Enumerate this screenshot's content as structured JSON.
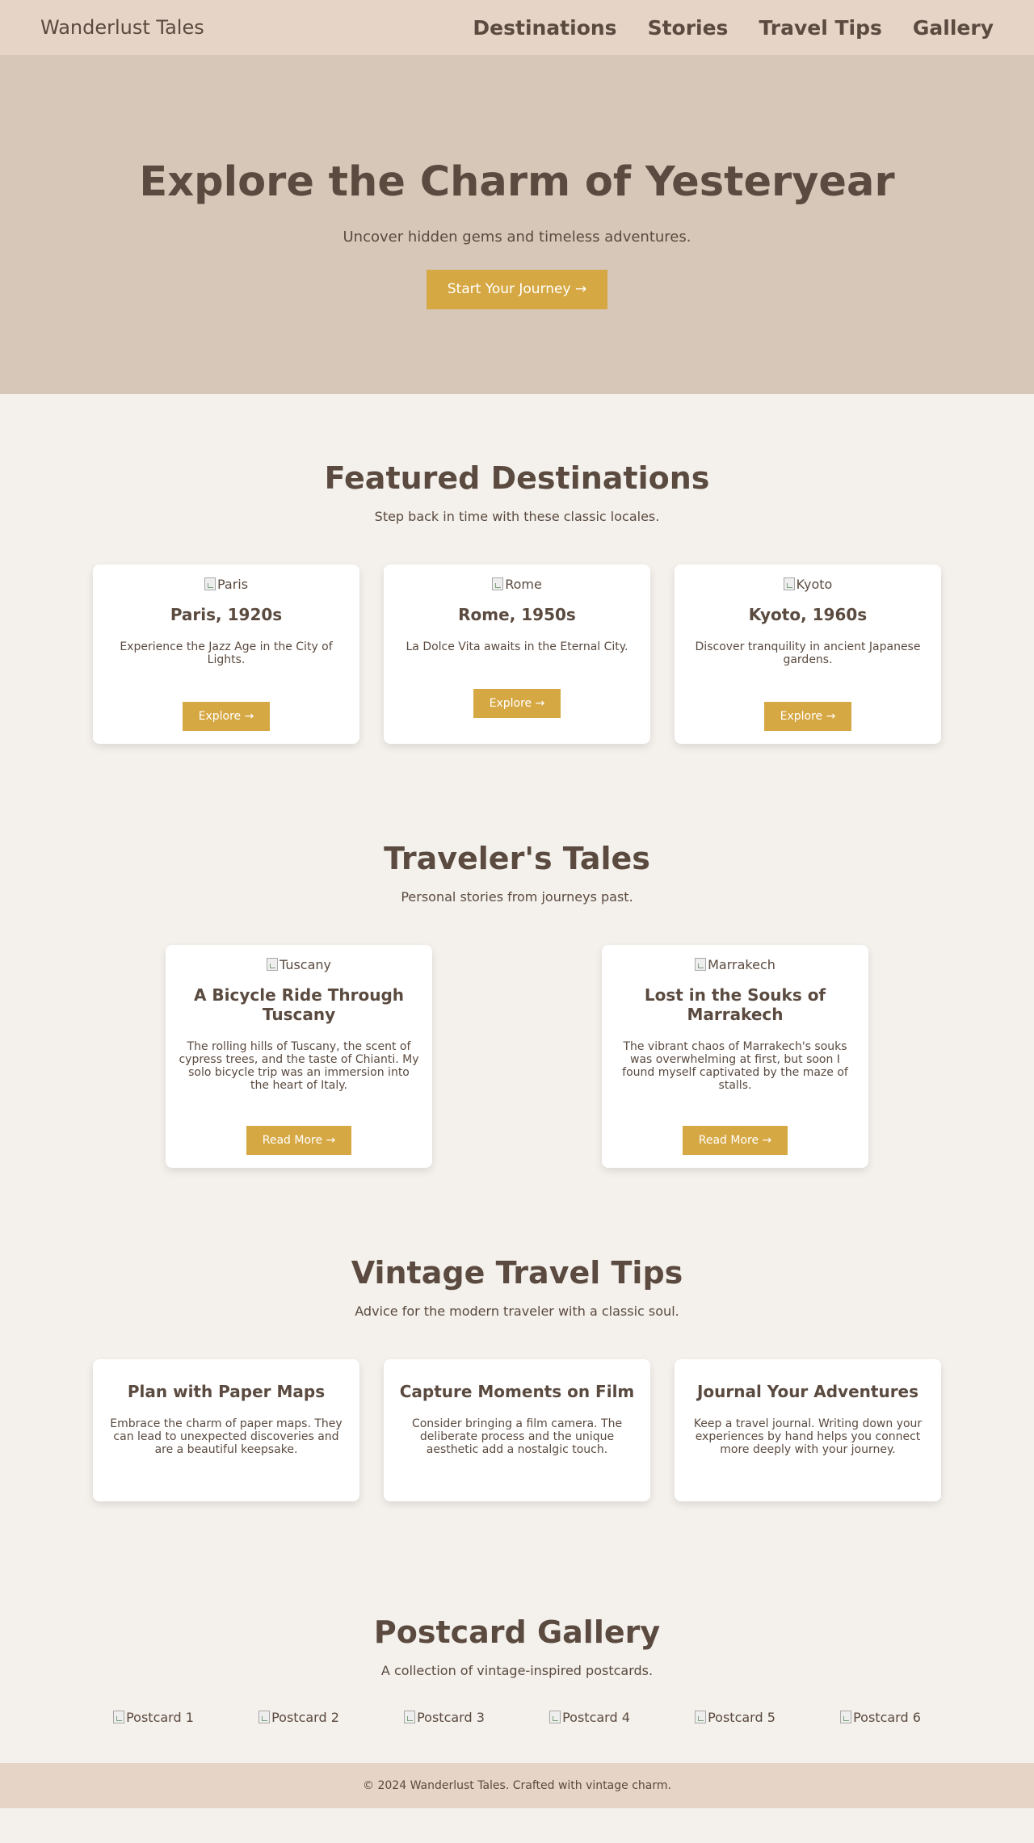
{
  "nav": {
    "logo": "Wanderlust Tales",
    "links": [
      "Destinations",
      "Stories",
      "Travel Tips",
      "Gallery"
    ]
  },
  "hero": {
    "title": "Explore the Charm of Yesteryear",
    "subtitle": "Uncover hidden gems and timeless adventures.",
    "cta": "Start Your Journey →"
  },
  "destinations": {
    "title": "Featured Destinations",
    "subtitle": "Step back in time with these classic locales.",
    "cards": [
      {
        "img_alt": "Paris",
        "title": "Paris, 1920s",
        "text": "Experience the Jazz Age in the City of Lights.",
        "button": "Explore →"
      },
      {
        "img_alt": "Rome",
        "title": "Rome, 1950s",
        "text": "La Dolce Vita awaits in the Eternal City.",
        "button": "Explore →"
      },
      {
        "img_alt": "Kyoto",
        "title": "Kyoto, 1960s",
        "text": "Discover tranquility in ancient Japanese gardens.",
        "button": "Explore →"
      }
    ]
  },
  "tales": {
    "title": "Traveler's Tales",
    "subtitle": "Personal stories from journeys past.",
    "cards": [
      {
        "img_alt": "Tuscany",
        "title": "A Bicycle Ride Through Tuscany",
        "text": "The rolling hills of Tuscany, the scent of cypress trees, and the taste of Chianti. My solo bicycle trip was an immersion into the heart of Italy.",
        "button": "Read More →"
      },
      {
        "img_alt": "Marrakech",
        "title": "Lost in the Souks of Marrakech",
        "text": "The vibrant chaos of Marrakech's souks was overwhelming at first, but soon I found myself captivated by the maze of stalls.",
        "button": "Read More →"
      }
    ]
  },
  "tips": {
    "title": "Vintage Travel Tips",
    "subtitle": "Advice for the modern traveler with a classic soul.",
    "cards": [
      {
        "title": "Plan with Paper Maps",
        "text": "Embrace the charm of paper maps. They can lead to unexpected discoveries and are a beautiful keepsake."
      },
      {
        "title": "Capture Moments on Film",
        "text": "Consider bringing a film camera. The deliberate process and the unique aesthetic add a nostalgic touch."
      },
      {
        "title": "Journal Your Adventures",
        "text": "Keep a travel journal. Writing down your experiences by hand helps you connect more deeply with your journey."
      }
    ]
  },
  "gallery": {
    "title": "Postcard Gallery",
    "subtitle": "A collection of vintage-inspired postcards.",
    "items": [
      "Postcard 1",
      "Postcard 2",
      "Postcard 3",
      "Postcard 4",
      "Postcard 5",
      "Postcard 6"
    ]
  },
  "footer": {
    "text": "© 2024 Wanderlust Tales. Crafted with vintage charm."
  },
  "colors": {
    "accent": "#d6a843",
    "nav_bg": "#e6d4c6",
    "hero_bg": "#d6c7b9",
    "page_bg": "#f4f0eb",
    "text": "#5a4a3f"
  }
}
